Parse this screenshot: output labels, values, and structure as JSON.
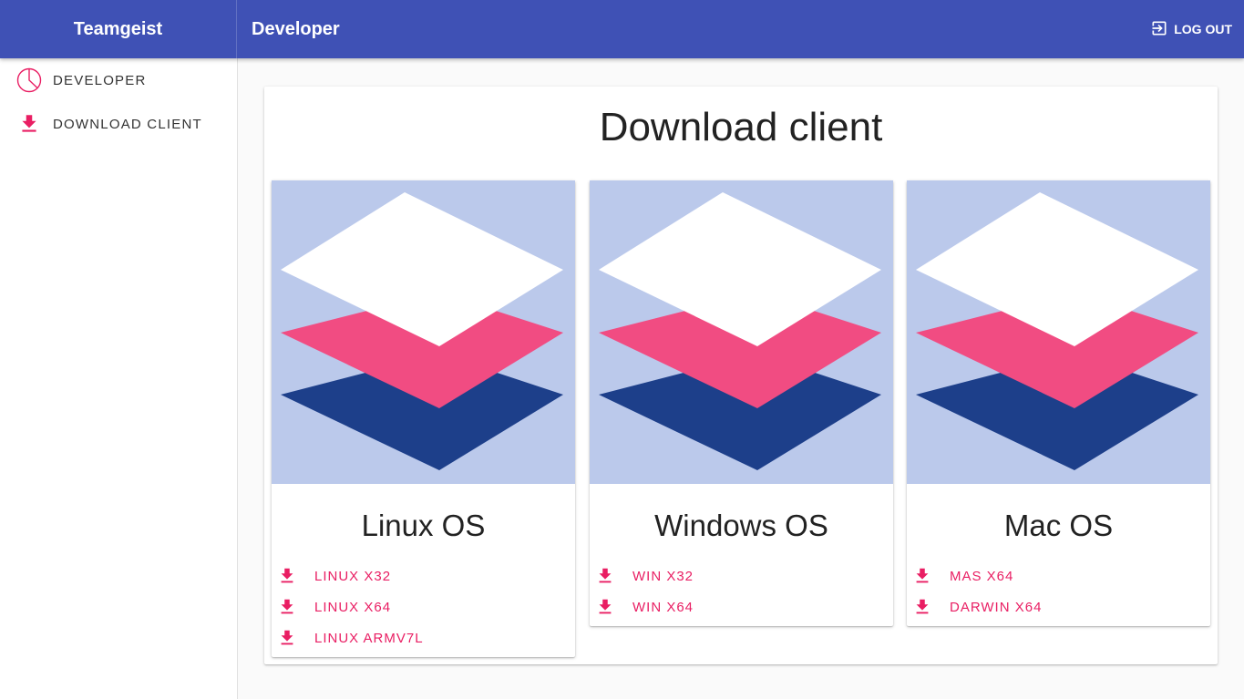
{
  "app": {
    "brand": "Teamgeist",
    "page_title": "Developer",
    "logout_label": "LOG OUT"
  },
  "colors": {
    "primary": "#3f51b5",
    "accent": "#e91e63",
    "art_bg": "#bbc9eb",
    "layer_top": "#ffffff",
    "layer_mid": "#f14c82",
    "layer_bottom": "#1d3f8a"
  },
  "sidebar": {
    "items": [
      {
        "label": "DEVELOPER",
        "icon": "pie-chart-icon"
      },
      {
        "label": "DOWNLOAD CLIENT",
        "icon": "download-icon"
      }
    ]
  },
  "main": {
    "title": "Download client",
    "cards": [
      {
        "os": "Linux OS",
        "icon": "layers-icon",
        "downloads": [
          "LINUX X32",
          "LINUX X64",
          "LINUX ARMV7L"
        ]
      },
      {
        "os": "Windows OS",
        "icon": "layers-icon",
        "downloads": [
          "WIN X32",
          "WIN X64"
        ]
      },
      {
        "os": "Mac OS",
        "icon": "layers-icon",
        "downloads": [
          "MAS X64",
          "DARWIN X64"
        ]
      }
    ]
  }
}
